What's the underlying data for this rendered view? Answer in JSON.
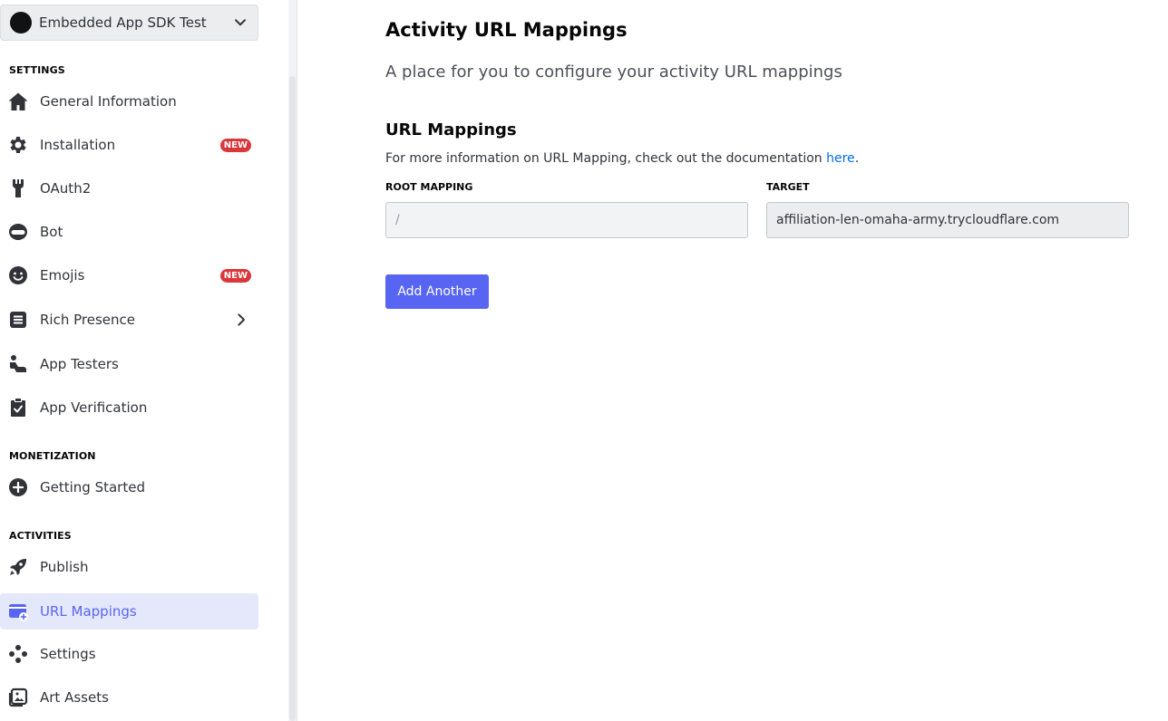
{
  "app_selector": {
    "name": "Embedded App SDK Test",
    "icon": "chevron-down-icon"
  },
  "sidebar": {
    "settings_header": "SETTINGS",
    "settings_items": [
      {
        "label": "General Information",
        "icon": "home-icon"
      },
      {
        "label": "Installation",
        "icon": "gear-icon",
        "badge": "NEW"
      },
      {
        "label": "OAuth2",
        "icon": "wrench-icon"
      },
      {
        "label": "Bot",
        "icon": "bot-icon"
      },
      {
        "label": "Emojis",
        "icon": "emoji-icon",
        "badge": "NEW"
      },
      {
        "label": "Rich Presence",
        "icon": "document-icon",
        "expand_icon": "chevron-right-icon"
      },
      {
        "label": "App Testers",
        "icon": "tester-icon"
      },
      {
        "label": "App Verification",
        "icon": "clipboard-check-icon"
      }
    ],
    "monetization_header": "MONETIZATION",
    "monetization_items": [
      {
        "label": "Getting Started",
        "icon": "plus-circle-icon"
      }
    ],
    "activities_header": "ACTIVITIES",
    "activities_items": [
      {
        "label": "Publish",
        "icon": "rocket-icon"
      },
      {
        "label": "URL Mappings",
        "icon": "url-mapping-icon",
        "active": true
      },
      {
        "label": "Settings",
        "icon": "gamepad-icon"
      },
      {
        "label": "Art Assets",
        "icon": "image-icon"
      }
    ]
  },
  "main": {
    "title": "Activity URL Mappings",
    "subtitle": "A place for you to configure your activity URL mappings",
    "section_title": "URL Mappings",
    "help_text": "For more information on URL Mapping, check out the documentation ",
    "help_link": "here",
    "help_suffix": ".",
    "root_label": "ROOT MAPPING",
    "root_placeholder": "/",
    "root_value": "",
    "target_label": "TARGET",
    "target_value": "affiliation-len-omaha-army.trycloudflare.com",
    "add_button": "Add Another"
  },
  "colors": {
    "accent": "#5865f2",
    "active_bg": "#e5e8fb",
    "badge": "#da373c",
    "link": "#006ce7"
  }
}
